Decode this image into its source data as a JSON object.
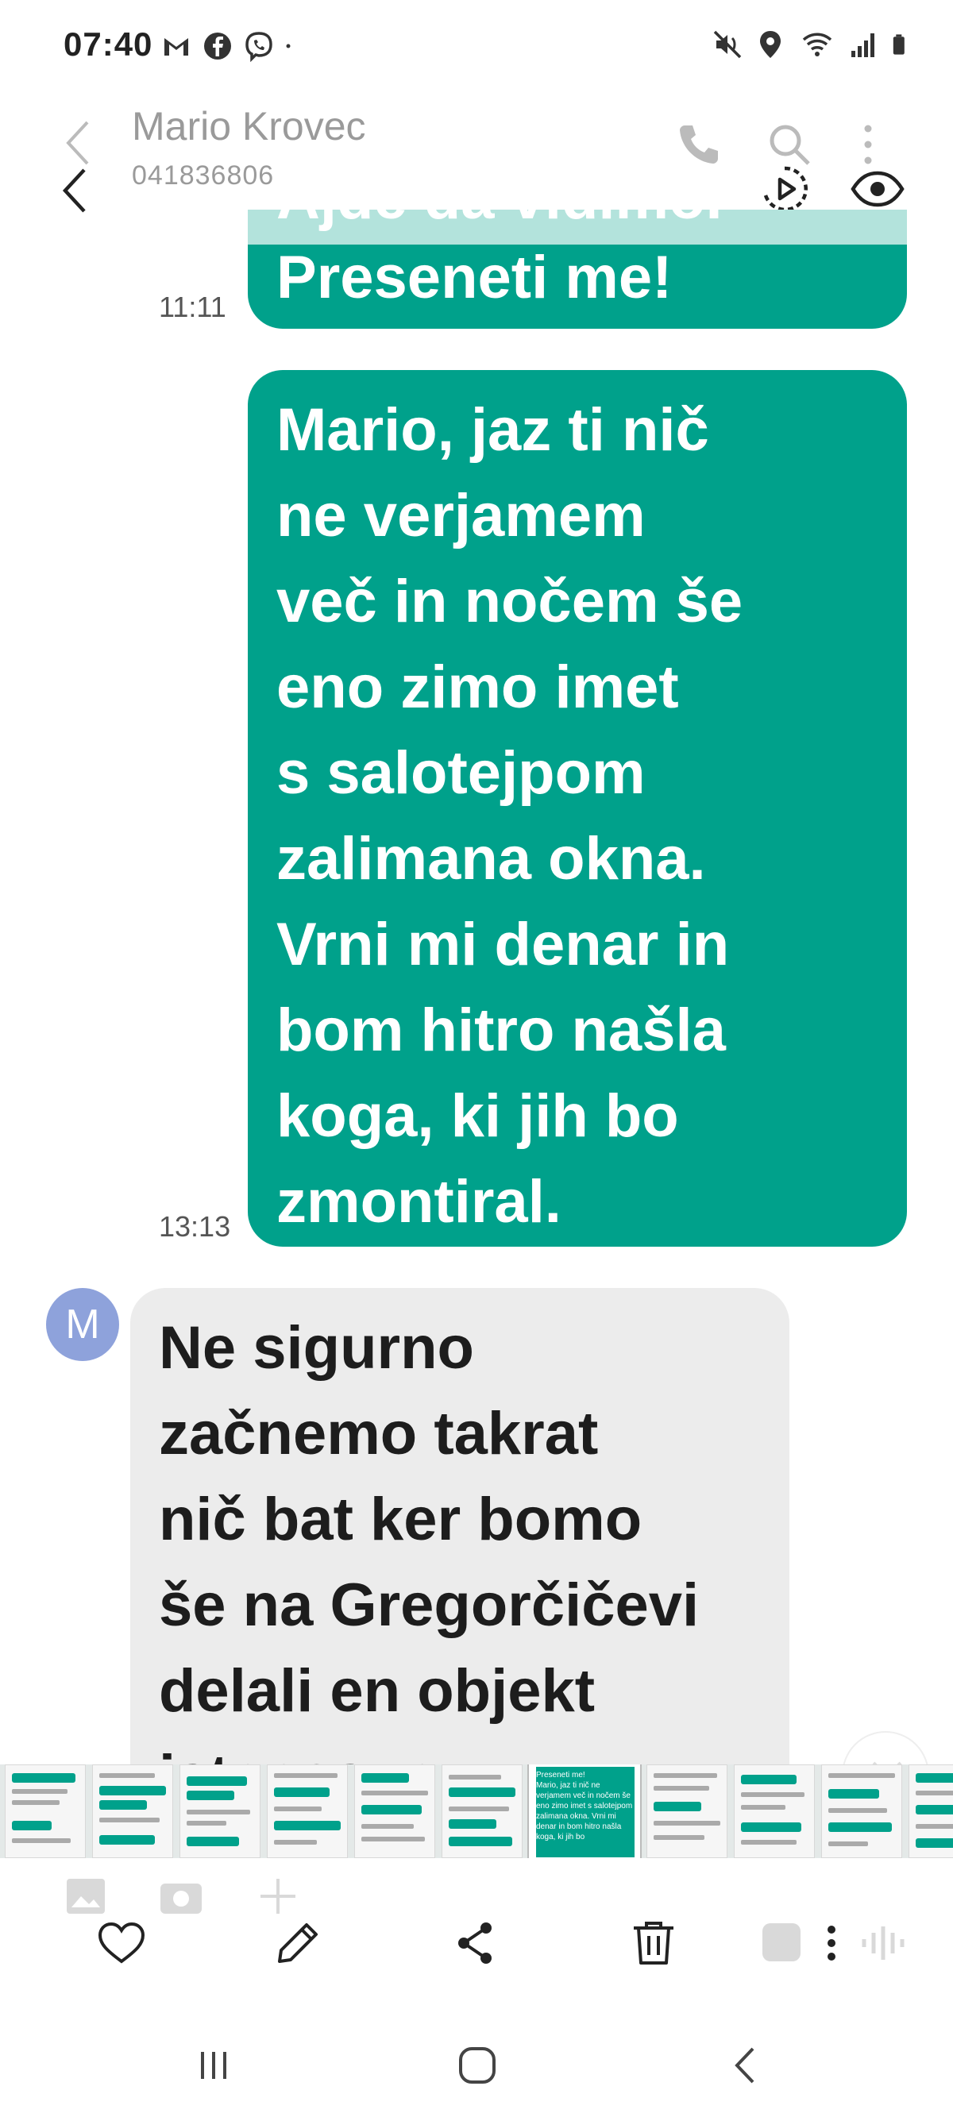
{
  "status_bar": {
    "time": "07:40",
    "left_icons": [
      "gmail-icon",
      "facebook-icon",
      "viber-icon",
      "dot-icon"
    ],
    "right_icons": [
      "mute-icon",
      "location-icon",
      "wifi-icon",
      "signal-icon",
      "battery-icon"
    ]
  },
  "header": {
    "contact_name": "Mario Krovec",
    "contact_number": "041836806"
  },
  "messages": [
    {
      "direction": "outgoing",
      "partial_top": "Ajde da vidimo.",
      "text": "Preseneti me!",
      "time": "11:11"
    },
    {
      "direction": "outgoing",
      "text": "Mario, jaz ti nič\nne verjamem\nveč in  nočem še\neno zimo imet\ns salotejpom\nzalimana okna.\nVrni mi denar in\nbom hitro našla\nkoga, ki jih bo\nzmontiral.",
      "time": "13:13"
    },
    {
      "direction": "incoming",
      "avatar_letter": "M",
      "text": "Ne sigurno\nzačnemo takrat\nnič bat ker bomo\nše na Gregorčičevi\ndelali en objekt\nistocasno"
    }
  ],
  "filmstrip": {
    "current_thumb_text": "Preseneti me!\nMario, jaz ti nič ne verjamem več in nočem še eno zimo imet s salotejpom zalimana okna. Vrni mi denar in bom hitro našla koga, ki jih bo"
  },
  "actions": {
    "items": [
      "heart-icon",
      "edit-icon",
      "share-icon",
      "delete-icon",
      "more-icon"
    ]
  },
  "colors": {
    "outgoing_bubble": "#00a18b",
    "incoming_bubble": "#ececec",
    "avatar": "#8ea2db"
  }
}
